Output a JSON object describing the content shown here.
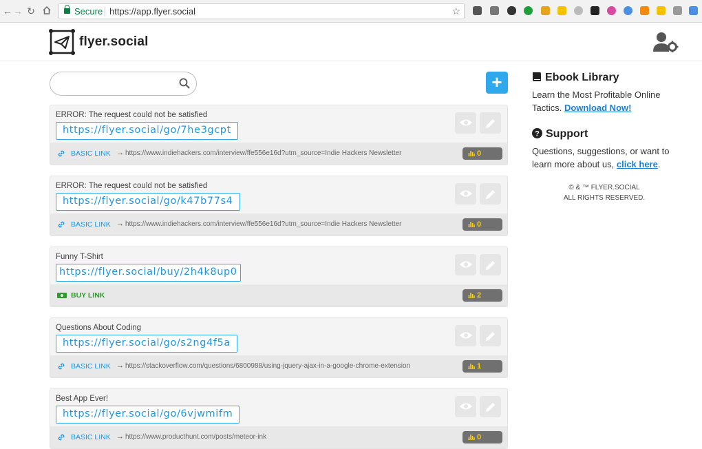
{
  "browser": {
    "secure_label": "Secure",
    "url": "https://app.flyer.social"
  },
  "app": {
    "name": "flyer.social"
  },
  "search": {
    "placeholder": "",
    "value": ""
  },
  "links": [
    {
      "title": "ERROR: The request could not be satisfied",
      "short_url": "https://flyer.social/go/7he3gcpt",
      "type": "BASIC LINK",
      "destination": "https://www.indiehackers.com/interview/ffe556e16d?utm_source=Indie Hackers Newsletter",
      "clicks": "0"
    },
    {
      "title": "ERROR: The request could not be satisfied",
      "short_url": "https://flyer.social/go/k47b77s4",
      "type": "BASIC LINK",
      "destination": "https://www.indiehackers.com/interview/ffe556e16d?utm_source=Indie Hackers Newsletter",
      "clicks": "0"
    },
    {
      "title": "Funny T-Shirt",
      "short_url": "https://flyer.social/buy/2h4k8up0",
      "type": "BUY LINK",
      "destination": "",
      "clicks": "2"
    },
    {
      "title": "Questions About Coding",
      "short_url": "https://flyer.social/go/s2ng4f5a",
      "type": "BASIC LINK",
      "destination": "https://stackoverflow.com/questions/6800988/using-jquery-ajax-in-a-google-chrome-extension",
      "clicks": "1"
    },
    {
      "title": "Best App Ever!",
      "short_url": "https://flyer.social/go/6vjwmifm",
      "type": "BASIC LINK",
      "destination": "https://www.producthunt.com/posts/meteor-ink",
      "clicks": "0"
    }
  ],
  "sidebar": {
    "ebook": {
      "heading": "Ebook Library",
      "text": "Learn the Most Profitable Online Tactics.",
      "link": "Download Now!"
    },
    "support": {
      "heading": "Support",
      "text": "Questions, suggestions, or want to learn more about us,",
      "link": "click here",
      "suffix": "."
    },
    "copyright_line1": "© & ™ FLYER.SOCIAL",
    "copyright_line2": "ALL RIGHTS RESERVED."
  },
  "icons": {
    "back": "back-arrow-icon",
    "forward": "forward-arrow-icon",
    "reload": "reload-icon",
    "home": "home-icon",
    "bookmark": "star-icon",
    "search": "search-icon",
    "add": "plus-icon",
    "preview": "eye-icon",
    "edit": "pencil-icon",
    "basic_link": "link-icon",
    "buy_link": "money-icon",
    "stats": "bar-chart-icon",
    "account": "user-settings-icon",
    "ebook": "book-icon",
    "support": "question-circle-icon"
  },
  "colors": {
    "accent": "#2fa8ec",
    "link": "#2196e0",
    "buy": "#2e9d2e",
    "badge_bg": "#707070",
    "badge_fg": "#f7cf1e"
  }
}
